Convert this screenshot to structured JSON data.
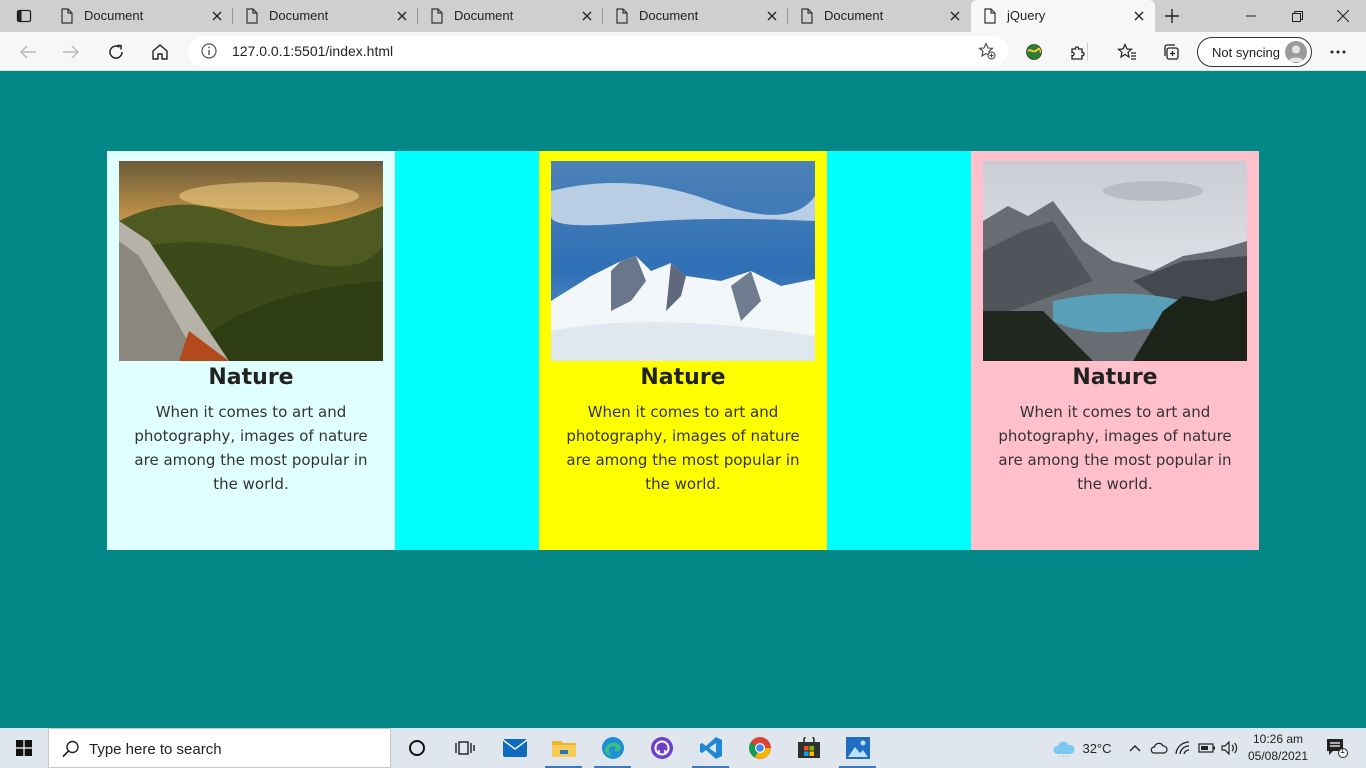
{
  "browser": {
    "tabs": [
      {
        "label": "Document",
        "active": false
      },
      {
        "label": "Document",
        "active": false
      },
      {
        "label": "Document",
        "active": false
      },
      {
        "label": "Document",
        "active": false
      },
      {
        "label": "Document",
        "active": false
      },
      {
        "label": "jQuery",
        "active": true
      }
    ],
    "address": {
      "url": "127.0.0.1:5501/index.html"
    },
    "sync_label": "Not syncing",
    "colors": {
      "tabstrip": "#cfcfcf",
      "toolbar": "#f7f7f7"
    }
  },
  "page": {
    "background": "#038787",
    "row_background": "#00ffff",
    "cards": [
      {
        "title": "Nature",
        "text": "When it comes to art and photography, images of nature are among the most popular in the world.",
        "background": "#e0ffff",
        "image": "autumn-forest-valley-photo"
      },
      {
        "title": "Nature",
        "text": "When it comes to art and photography, images of nature are among the most popular in the world.",
        "background": "#ffff00",
        "image": "snowy-mountain-peaks-photo"
      },
      {
        "title": "Nature",
        "text": "When it comes to art and photography, images of nature are among the most popular in the world.",
        "background": "#ffc0cb",
        "image": "mountain-lake-valley-photo"
      }
    ]
  },
  "taskbar": {
    "search_placeholder": "Type here to search",
    "apps": [
      "cortana-icon",
      "task-view-icon",
      "mail-icon",
      "file-explorer-icon",
      "edge-icon",
      "github-desktop-icon",
      "vscode-icon",
      "chrome-icon",
      "store-icon",
      "photos-icon"
    ],
    "weather": "32°C",
    "time": "10:26 am",
    "date": "05/08/2021",
    "notification_count": "1"
  }
}
